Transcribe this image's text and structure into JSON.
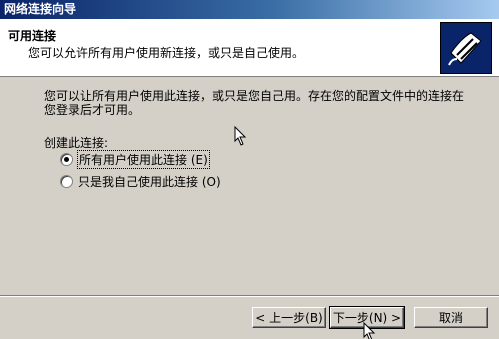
{
  "window": {
    "title": "网络连接向导"
  },
  "header": {
    "title": "可用连接",
    "subtitle": "您可以允许所有用户使用新连接，或只是自己使用。",
    "icon": "network-cable-icon"
  },
  "body": {
    "description": "您可以让所有用户使用此连接，或只是您自己用。存在您的配置文件中的连接在您登录后才可用。",
    "group_label": "创建此连接:",
    "options": [
      {
        "label": "所有用户使用此连接 (E)",
        "selected": true
      },
      {
        "label": "只是我自己使用此连接 (O)",
        "selected": false
      }
    ]
  },
  "buttons": {
    "back": "< 上一步(B)",
    "next": "下一步(N) >",
    "cancel": "取消"
  }
}
